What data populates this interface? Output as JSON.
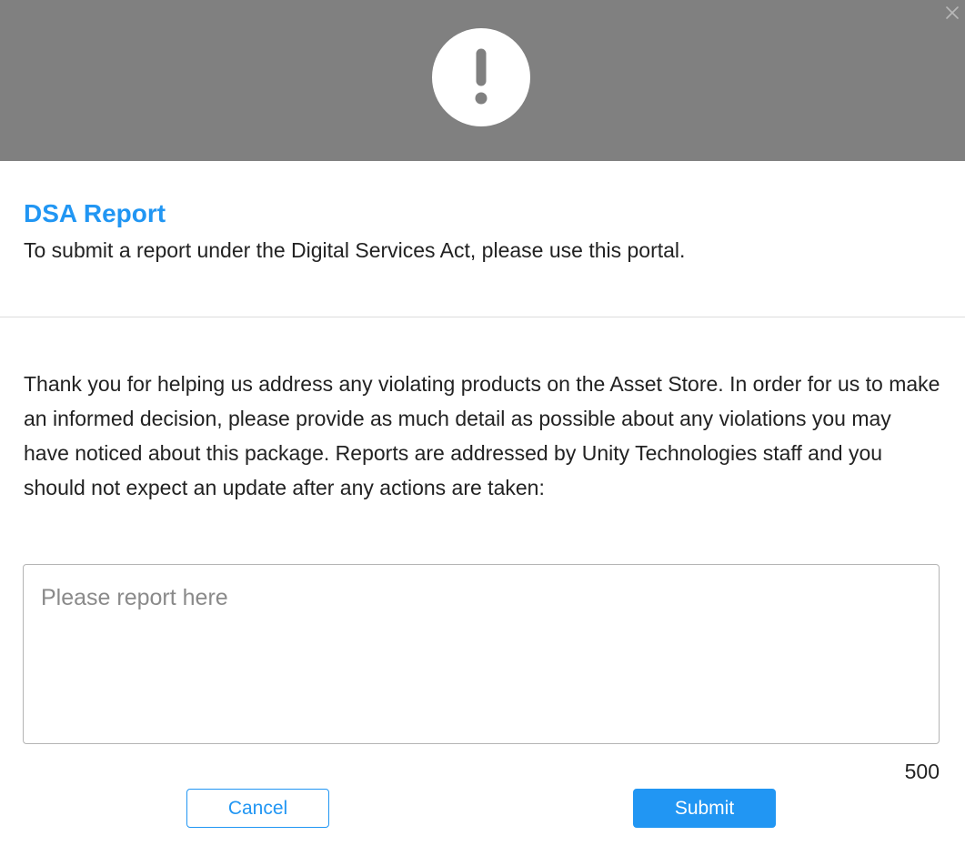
{
  "dialog": {
    "title": "DSA Report",
    "subtitle": "To submit a report under the Digital Services Act, please use this portal.",
    "instructions": "Thank you for helping us address any violating products on the Asset Store. In order for us to make an informed decision, please provide as much detail as possible about any violations you may have noticed about this package. Reports are addressed by Unity Technologies staff and you should not expect an update after any actions are taken:",
    "report_field": {
      "value": "",
      "placeholder": "Please report here"
    },
    "char_count": "500",
    "cancel_label": "Cancel",
    "submit_label": "Submit"
  },
  "icons": {
    "header": "exclamation-icon",
    "close": "close-icon"
  },
  "colors": {
    "header_background": "#808080",
    "accent": "#2196f3"
  }
}
